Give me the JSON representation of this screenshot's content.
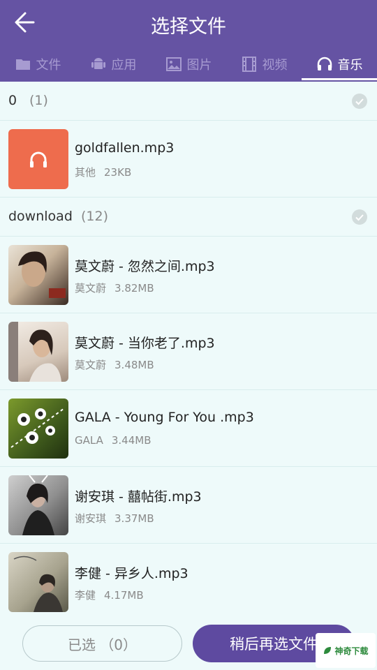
{
  "header": {
    "title": "选择文件"
  },
  "tabs": [
    {
      "label": "文件",
      "icon": "folder-icon"
    },
    {
      "label": "应用",
      "icon": "android-icon"
    },
    {
      "label": "图片",
      "icon": "image-icon"
    },
    {
      "label": "视频",
      "icon": "film-icon"
    },
    {
      "label": "音乐",
      "icon": "headphones-icon",
      "active": true
    }
  ],
  "sections": [
    {
      "name": "0",
      "count": "(1)"
    },
    {
      "name": "download",
      "count": "(12)"
    }
  ],
  "files": [
    {
      "name": "goldfallen.mp3",
      "artist": "其他",
      "size": "23KB"
    },
    {
      "name": "莫文蔚 - 忽然之间.mp3",
      "artist": "莫文蔚",
      "size": "3.82MB"
    },
    {
      "name": "莫文蔚 - 当你老了.mp3",
      "artist": "莫文蔚",
      "size": "3.48MB"
    },
    {
      "name": "GALA - Young For You .mp3",
      "artist": "GALA",
      "size": "3.44MB"
    },
    {
      "name": "谢安琪 - 囍帖街.mp3",
      "artist": "谢安琪",
      "size": "3.37MB"
    },
    {
      "name": "李健 - 异乡人.mp3",
      "artist": "李健",
      "size": "4.17MB"
    }
  ],
  "bottom": {
    "selected_label": "已选 （0）",
    "later_label": "稍后再选文件"
  },
  "watermark": {
    "text": "神奇下载"
  },
  "colors": {
    "header": "#6553a3",
    "accent": "#5e4aa0",
    "default_thumb": "#ee6c4d",
    "background": "#eefafa"
  }
}
